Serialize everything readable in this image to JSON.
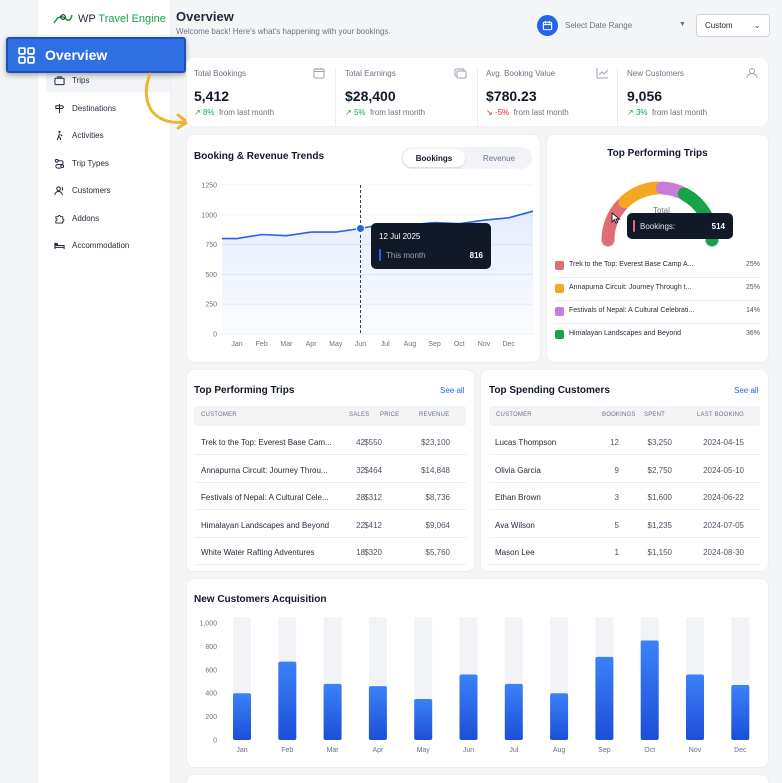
{
  "sidebar": {
    "logo_prefix": "WP",
    "logo_accent": "Travel Engine",
    "items": [
      {
        "label": "Trips",
        "icon": "suitcase-icon"
      },
      {
        "label": "Destinations",
        "icon": "signpost-icon"
      },
      {
        "label": "Activities",
        "icon": "hiking-icon"
      },
      {
        "label": "Trip Types",
        "icon": "route-icon"
      },
      {
        "label": "Customers",
        "icon": "users-icon"
      },
      {
        "label": "Addons",
        "icon": "puzzle-icon"
      },
      {
        "label": "Accommodation",
        "icon": "bed-icon"
      }
    ]
  },
  "callout": {
    "label": "Overview",
    "icon": "grid-icon"
  },
  "header": {
    "title": "Overview",
    "subtitle": "Welcome back! Here's what's happening with your bookings.",
    "date_range_placeholder": "Select Date Range",
    "range_value": "Custom"
  },
  "stats": [
    {
      "label": "Total Bookings",
      "value": "5,412",
      "change": "8%",
      "direction": "up",
      "note": "from last month",
      "icon": "calendar-icon"
    },
    {
      "label": "Total Earnings",
      "value": "$28,400",
      "change": "5%",
      "direction": "up",
      "note": "from last month",
      "icon": "cash-icon"
    },
    {
      "label": "Avg. Booking Value",
      "value": "$780.23",
      "change": "-5%",
      "direction": "down",
      "note": "from last month",
      "icon": "trend-icon"
    },
    {
      "label": "New Customers",
      "value": "9,056",
      "change": "3%",
      "direction": "up",
      "note": "from last month",
      "icon": "user-icon"
    }
  ],
  "trends": {
    "title": "Booking & Revenue Trends",
    "toggle": [
      "Bookings",
      "Revenue"
    ],
    "tooltip": {
      "date": "12 Jul 2025",
      "label": "This month",
      "value": "816"
    }
  },
  "top_trips_gauge": {
    "title": "Top Performing Trips",
    "center_label": "Total",
    "tooltip_label": "Bookings:",
    "tooltip_value": "514",
    "legend": [
      {
        "name": "Trek to the Top: Everest Base Camp A...",
        "pct": "25%",
        "color": "#e06c75"
      },
      {
        "name": "Annapurna Circuit: Journey Through t...",
        "pct": "25%",
        "color": "#f5a623"
      },
      {
        "name": "Festivals of Nepal: A Cultural Celebrati...",
        "pct": "14%",
        "color": "#c77dd9"
      },
      {
        "name": "Himalayan Landscapes and Beyond",
        "pct": "36%",
        "color": "#16a34a"
      }
    ]
  },
  "trips_table": {
    "title": "Top Performing Trips",
    "see_all": "See all",
    "columns": [
      "Customer",
      "Sales",
      "Price",
      "Revenue"
    ],
    "rows": [
      [
        "Trek to the Top: Everest Base Cam...",
        "42",
        "$550",
        "$23,100"
      ],
      [
        "Annapurna Circuit: Journey Throu...",
        "32",
        "$464",
        "$14,848"
      ],
      [
        "Festivals of Nepal: A Cultural Cele...",
        "28",
        "$312",
        "$8,736"
      ],
      [
        "Himalayan Landscapes and Beyond",
        "22",
        "$412",
        "$9,064"
      ],
      [
        "White Water Rafting Adventures",
        "18",
        "$320",
        "$5,760"
      ]
    ]
  },
  "customers_table": {
    "title": "Top Spending Customers",
    "see_all": "See all",
    "columns": [
      "Customer",
      "Bookings",
      "Spent",
      "Last Booking"
    ],
    "rows": [
      [
        "Lucas Thompson",
        "12",
        "$3,250",
        "2024-04-15"
      ],
      [
        "Olivia Garcia",
        "9",
        "$2,750",
        "2024-05-10"
      ],
      [
        "Ethan Brown",
        "3",
        "$1,600",
        "2024-06-22"
      ],
      [
        "Ava Wilson",
        "5",
        "$1,235",
        "2024-07-05"
      ],
      [
        "Mason Lee",
        "1",
        "$1,150",
        "2024-08-30"
      ]
    ]
  },
  "chart_data": [
    {
      "type": "line",
      "title": "Booking & Revenue Trends",
      "ylim": [
        0,
        1250
      ],
      "yticks": [
        "0",
        "250",
        "500",
        "750",
        "1000",
        "1250"
      ],
      "categories": [
        "Jan",
        "Feb",
        "Mar",
        "Apr",
        "May",
        "Jun",
        "Jul",
        "Aug",
        "Sep",
        "Oct",
        "Nov",
        "Dec"
      ],
      "series": [
        {
          "name": "Bookings",
          "values": [
            800,
            835,
            825,
            855,
            855,
            885,
            925,
            915,
            935,
            925,
            955,
            975
          ]
        }
      ],
      "end_value": 1030,
      "highlight_index": 5,
      "color": "#2563eb"
    },
    {
      "type": "bar",
      "title": "New Customers Acquisition",
      "ylim": [
        0,
        1000
      ],
      "yticks": [
        "0",
        "200",
        "400",
        "600",
        "800",
        "1,000"
      ],
      "categories": [
        "Jan",
        "Feb",
        "Mar",
        "Apr",
        "May",
        "Jun",
        "Jul",
        "Aug",
        "Sep",
        "Oct",
        "Nov",
        "Dec"
      ],
      "values": [
        400,
        670,
        480,
        460,
        350,
        560,
        480,
        400,
        710,
        850,
        560,
        470
      ],
      "color": "#2563eb"
    }
  ]
}
